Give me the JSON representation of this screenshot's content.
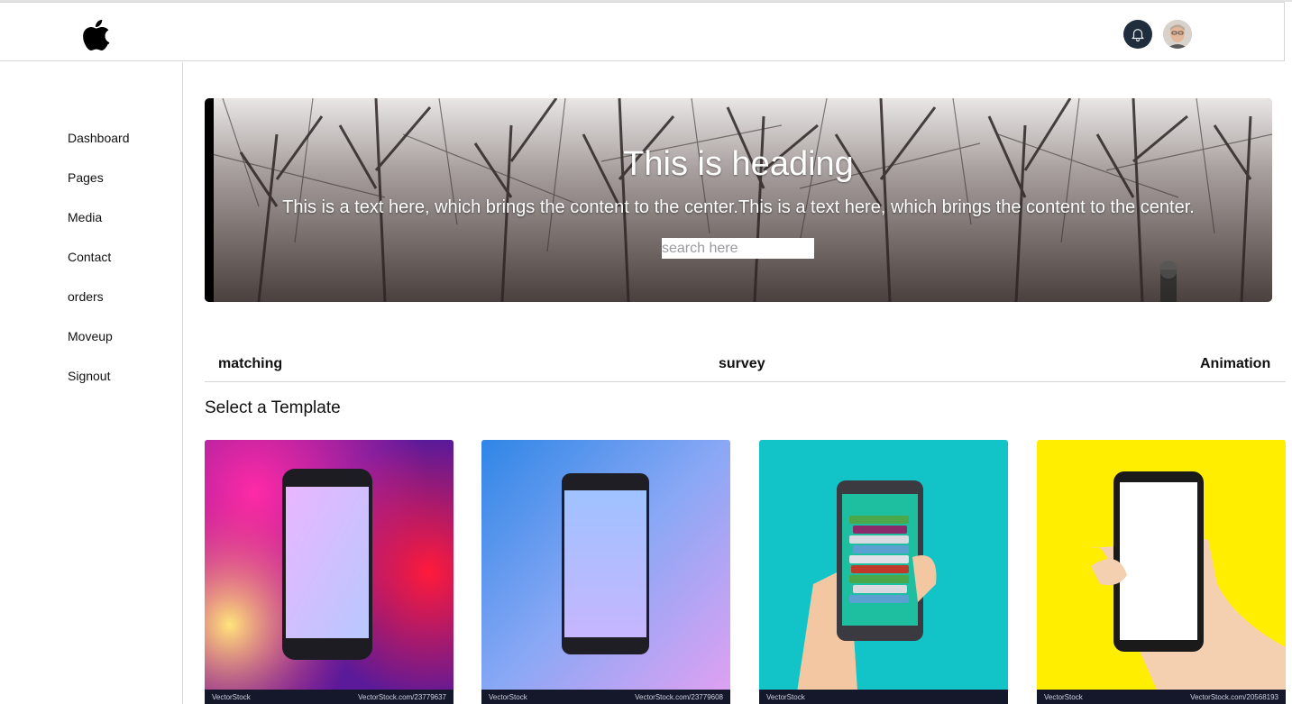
{
  "sidebar": {
    "items": [
      {
        "label": "Dashboard"
      },
      {
        "label": "Pages"
      },
      {
        "label": "Media"
      },
      {
        "label": "Contact"
      },
      {
        "label": "orders"
      },
      {
        "label": "Moveup"
      },
      {
        "label": "Signout"
      }
    ]
  },
  "hero": {
    "heading": "This is heading",
    "text": "This is a text here, which brings the content to the center.This is a text here, which brings the content to the center.",
    "search_placeholder": "search here"
  },
  "tabs": [
    {
      "label": "matching"
    },
    {
      "label": "survey"
    },
    {
      "label": "Animation"
    }
  ],
  "templates": {
    "title": "Select a Template",
    "cards": [
      {
        "watermark": "VectorStock",
        "id_text": "VectorStock.com/23779637"
      },
      {
        "watermark": "VectorStock",
        "id_text": "VectorStock.com/23779608"
      },
      {
        "watermark": "VectorStock",
        "id_text": ""
      },
      {
        "watermark": "VectorStock",
        "id_text": "VectorStock.com/20568193"
      }
    ]
  },
  "icons": {
    "logo": "apple-logo-icon",
    "notifications": "bell-icon",
    "avatar": "user-avatar"
  },
  "colors": {
    "bell_bg": "#1f2d3d",
    "card3_bg": "#12c3c8",
    "card4_bg": "#ffee00"
  }
}
